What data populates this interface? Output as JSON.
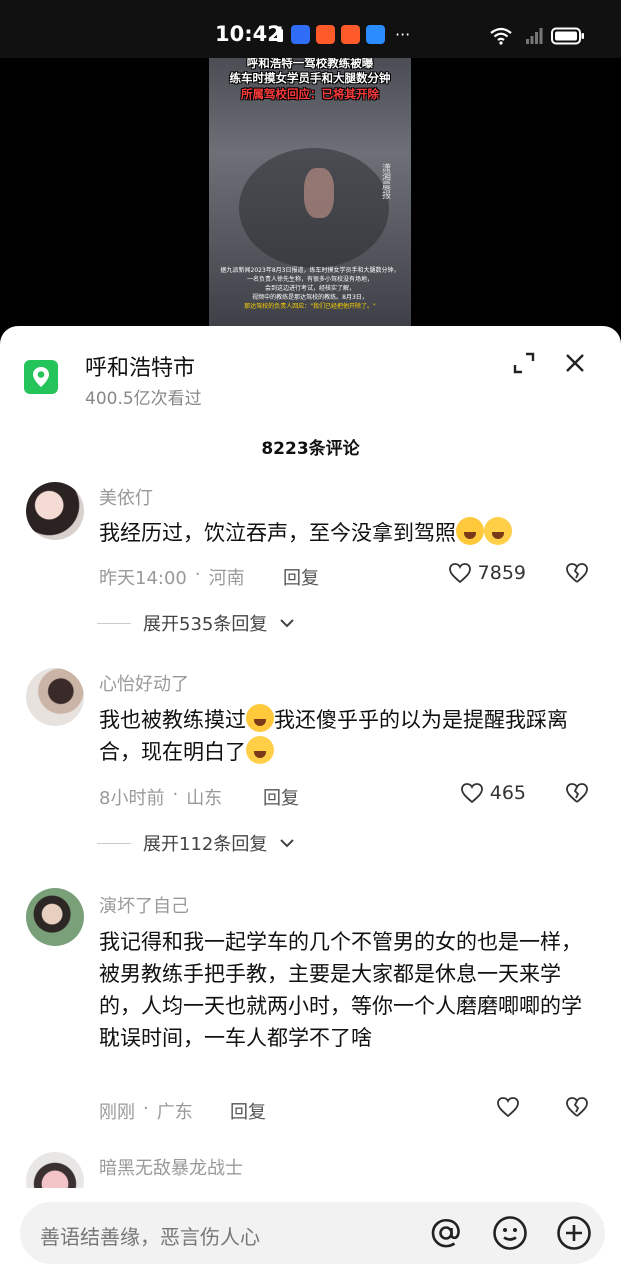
{
  "status_bar": {
    "time": "10:42",
    "notification_colors": [
      "#2f6df6",
      "#ff5a2a",
      "#ff5a2a",
      "#2a8cff"
    ],
    "more": "···"
  },
  "video": {
    "headline_top": "呼和浩特一驾校教练被曝",
    "headline_mid": "练车时摸女学员手和大腿数分钟",
    "headline_red": "所属驾校回应：已将其开除",
    "watermark": "潇湘晨报",
    "caption_lines": [
      "据九派新闻2023年8月3日报道，练车时摸女学员手和大腿数分钟，",
      "一名负责人徐先生称，有很多小驾校没有场地，",
      "会到这边进行考试，经核实了解，",
      "视频中的教练是那达驾校的教练。8月3日，",
      "那达驾校的负责人回应：\"我们已经把他开除了。\""
    ]
  },
  "location": {
    "title": "呼和浩特市",
    "views": "400.5亿次看过",
    "icon": "location-pin-icon",
    "accent": "#24c45a"
  },
  "comments_count": "8223条评论",
  "comments": [
    {
      "user": "美依仃",
      "text": "我经历过，饮泣吞声，至今没拿到驾照",
      "time": "昨天14:00",
      "sep": "·",
      "location": "河南",
      "reply": "回复",
      "likes": "7859",
      "expand": "展开535条回复"
    },
    {
      "user": "心怡好动了",
      "text_a": "我也被教练摸过",
      "text_b": "我还傻乎乎的以为是提醒我踩离合，现在明白了",
      "time": "8小时前",
      "sep": "·",
      "location": "山东",
      "reply": "回复",
      "likes": "465",
      "expand": "展开112条回复"
    },
    {
      "user": "演坏了自己",
      "text": "我记得和我一起学车的几个不管男的女的也是一样，被男教练手把手教，主要是大家都是休息一天来学的，人均一天也就两小时，等你一个人磨磨唧唧的学耽误时间，一车人都学不了啥",
      "time": "刚刚",
      "sep": "·",
      "location": "广东",
      "reply": "回复",
      "likes": ""
    },
    {
      "user": "暗黑无敌暴龙战士"
    }
  ],
  "input": {
    "placeholder": "善语结善缘，恶言伤人心",
    "icons": [
      "at-icon",
      "emoji-icon",
      "add-icon"
    ]
  }
}
